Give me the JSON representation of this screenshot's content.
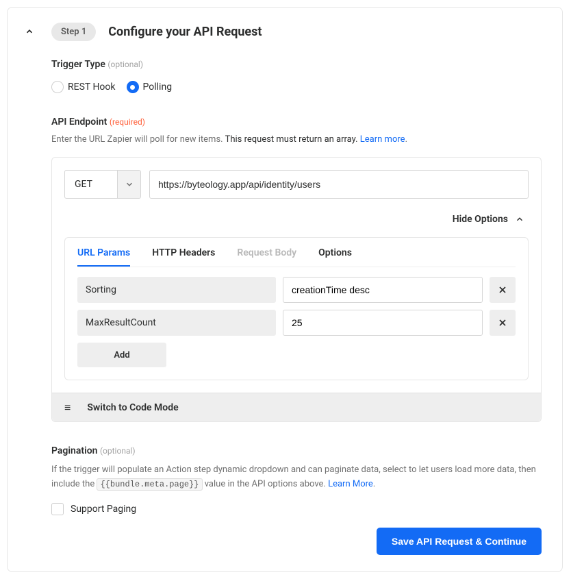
{
  "header": {
    "step_pill": "Step 1",
    "title": "Configure your API Request"
  },
  "trigger_type": {
    "label": "Trigger Type",
    "optional_tag": "(optional)",
    "options": [
      {
        "label": "REST Hook",
        "selected": false
      },
      {
        "label": "Polling",
        "selected": true
      }
    ]
  },
  "api_endpoint": {
    "label": "API Endpoint",
    "required_tag": "(required)",
    "helper_prefix": "Enter the URL Zapier will poll for new items. ",
    "helper_emph": "This request must return an array.",
    "learn_more": "Learn more",
    "method": "GET",
    "url": "https://byteology.app/api/identity/users",
    "options_toggle": "Hide Options"
  },
  "tabs": [
    {
      "label": "URL Params",
      "active": true
    },
    {
      "label": "HTTP Headers"
    },
    {
      "label": "Request Body",
      "disabled": true
    },
    {
      "label": "Options"
    }
  ],
  "url_params": [
    {
      "key": "Sorting",
      "value": "creationTime desc"
    },
    {
      "key": "MaxResultCount",
      "value": "25"
    }
  ],
  "add_label": "Add",
  "code_mode": "Switch to Code Mode",
  "pagination": {
    "label": "Pagination",
    "optional_tag": "(optional)",
    "helper_prefix": "If the trigger will populate an Action step dynamic dropdown and can paginate data, select to let users load more data, then include the ",
    "code_chip": "{{bundle.meta.page}}",
    "helper_suffix": " value in the API options above. ",
    "learn_more": "Learn More",
    "checkbox_label": "Support Paging"
  },
  "save_btn": "Save API Request & Continue"
}
